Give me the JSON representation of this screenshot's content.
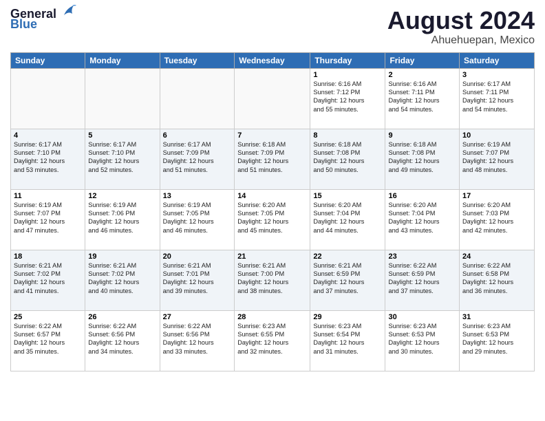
{
  "header": {
    "logo_general": "General",
    "logo_blue": "Blue",
    "month_title": "August 2024",
    "location": "Ahuehuepan, Mexico"
  },
  "weekdays": [
    "Sunday",
    "Monday",
    "Tuesday",
    "Wednesday",
    "Thursday",
    "Friday",
    "Saturday"
  ],
  "weeks": [
    [
      {
        "day": "",
        "text": "",
        "empty": true
      },
      {
        "day": "",
        "text": "",
        "empty": true
      },
      {
        "day": "",
        "text": "",
        "empty": true
      },
      {
        "day": "",
        "text": "",
        "empty": true
      },
      {
        "day": "1",
        "text": "Sunrise: 6:16 AM\nSunset: 7:12 PM\nDaylight: 12 hours\nand 55 minutes.",
        "empty": false
      },
      {
        "day": "2",
        "text": "Sunrise: 6:16 AM\nSunset: 7:11 PM\nDaylight: 12 hours\nand 54 minutes.",
        "empty": false
      },
      {
        "day": "3",
        "text": "Sunrise: 6:17 AM\nSunset: 7:11 PM\nDaylight: 12 hours\nand 54 minutes.",
        "empty": false
      }
    ],
    [
      {
        "day": "4",
        "text": "Sunrise: 6:17 AM\nSunset: 7:10 PM\nDaylight: 12 hours\nand 53 minutes.",
        "empty": false
      },
      {
        "day": "5",
        "text": "Sunrise: 6:17 AM\nSunset: 7:10 PM\nDaylight: 12 hours\nand 52 minutes.",
        "empty": false
      },
      {
        "day": "6",
        "text": "Sunrise: 6:17 AM\nSunset: 7:09 PM\nDaylight: 12 hours\nand 51 minutes.",
        "empty": false
      },
      {
        "day": "7",
        "text": "Sunrise: 6:18 AM\nSunset: 7:09 PM\nDaylight: 12 hours\nand 51 minutes.",
        "empty": false
      },
      {
        "day": "8",
        "text": "Sunrise: 6:18 AM\nSunset: 7:08 PM\nDaylight: 12 hours\nand 50 minutes.",
        "empty": false
      },
      {
        "day": "9",
        "text": "Sunrise: 6:18 AM\nSunset: 7:08 PM\nDaylight: 12 hours\nand 49 minutes.",
        "empty": false
      },
      {
        "day": "10",
        "text": "Sunrise: 6:19 AM\nSunset: 7:07 PM\nDaylight: 12 hours\nand 48 minutes.",
        "empty": false
      }
    ],
    [
      {
        "day": "11",
        "text": "Sunrise: 6:19 AM\nSunset: 7:07 PM\nDaylight: 12 hours\nand 47 minutes.",
        "empty": false
      },
      {
        "day": "12",
        "text": "Sunrise: 6:19 AM\nSunset: 7:06 PM\nDaylight: 12 hours\nand 46 minutes.",
        "empty": false
      },
      {
        "day": "13",
        "text": "Sunrise: 6:19 AM\nSunset: 7:05 PM\nDaylight: 12 hours\nand 46 minutes.",
        "empty": false
      },
      {
        "day": "14",
        "text": "Sunrise: 6:20 AM\nSunset: 7:05 PM\nDaylight: 12 hours\nand 45 minutes.",
        "empty": false
      },
      {
        "day": "15",
        "text": "Sunrise: 6:20 AM\nSunset: 7:04 PM\nDaylight: 12 hours\nand 44 minutes.",
        "empty": false
      },
      {
        "day": "16",
        "text": "Sunrise: 6:20 AM\nSunset: 7:04 PM\nDaylight: 12 hours\nand 43 minutes.",
        "empty": false
      },
      {
        "day": "17",
        "text": "Sunrise: 6:20 AM\nSunset: 7:03 PM\nDaylight: 12 hours\nand 42 minutes.",
        "empty": false
      }
    ],
    [
      {
        "day": "18",
        "text": "Sunrise: 6:21 AM\nSunset: 7:02 PM\nDaylight: 12 hours\nand 41 minutes.",
        "empty": false
      },
      {
        "day": "19",
        "text": "Sunrise: 6:21 AM\nSunset: 7:02 PM\nDaylight: 12 hours\nand 40 minutes.",
        "empty": false
      },
      {
        "day": "20",
        "text": "Sunrise: 6:21 AM\nSunset: 7:01 PM\nDaylight: 12 hours\nand 39 minutes.",
        "empty": false
      },
      {
        "day": "21",
        "text": "Sunrise: 6:21 AM\nSunset: 7:00 PM\nDaylight: 12 hours\nand 38 minutes.",
        "empty": false
      },
      {
        "day": "22",
        "text": "Sunrise: 6:21 AM\nSunset: 6:59 PM\nDaylight: 12 hours\nand 37 minutes.",
        "empty": false
      },
      {
        "day": "23",
        "text": "Sunrise: 6:22 AM\nSunset: 6:59 PM\nDaylight: 12 hours\nand 37 minutes.",
        "empty": false
      },
      {
        "day": "24",
        "text": "Sunrise: 6:22 AM\nSunset: 6:58 PM\nDaylight: 12 hours\nand 36 minutes.",
        "empty": false
      }
    ],
    [
      {
        "day": "25",
        "text": "Sunrise: 6:22 AM\nSunset: 6:57 PM\nDaylight: 12 hours\nand 35 minutes.",
        "empty": false
      },
      {
        "day": "26",
        "text": "Sunrise: 6:22 AM\nSunset: 6:56 PM\nDaylight: 12 hours\nand 34 minutes.",
        "empty": false
      },
      {
        "day": "27",
        "text": "Sunrise: 6:22 AM\nSunset: 6:56 PM\nDaylight: 12 hours\nand 33 minutes.",
        "empty": false
      },
      {
        "day": "28",
        "text": "Sunrise: 6:23 AM\nSunset: 6:55 PM\nDaylight: 12 hours\nand 32 minutes.",
        "empty": false
      },
      {
        "day": "29",
        "text": "Sunrise: 6:23 AM\nSunset: 6:54 PM\nDaylight: 12 hours\nand 31 minutes.",
        "empty": false
      },
      {
        "day": "30",
        "text": "Sunrise: 6:23 AM\nSunset: 6:53 PM\nDaylight: 12 hours\nand 30 minutes.",
        "empty": false
      },
      {
        "day": "31",
        "text": "Sunrise: 6:23 AM\nSunset: 6:53 PM\nDaylight: 12 hours\nand 29 minutes.",
        "empty": false
      }
    ]
  ]
}
